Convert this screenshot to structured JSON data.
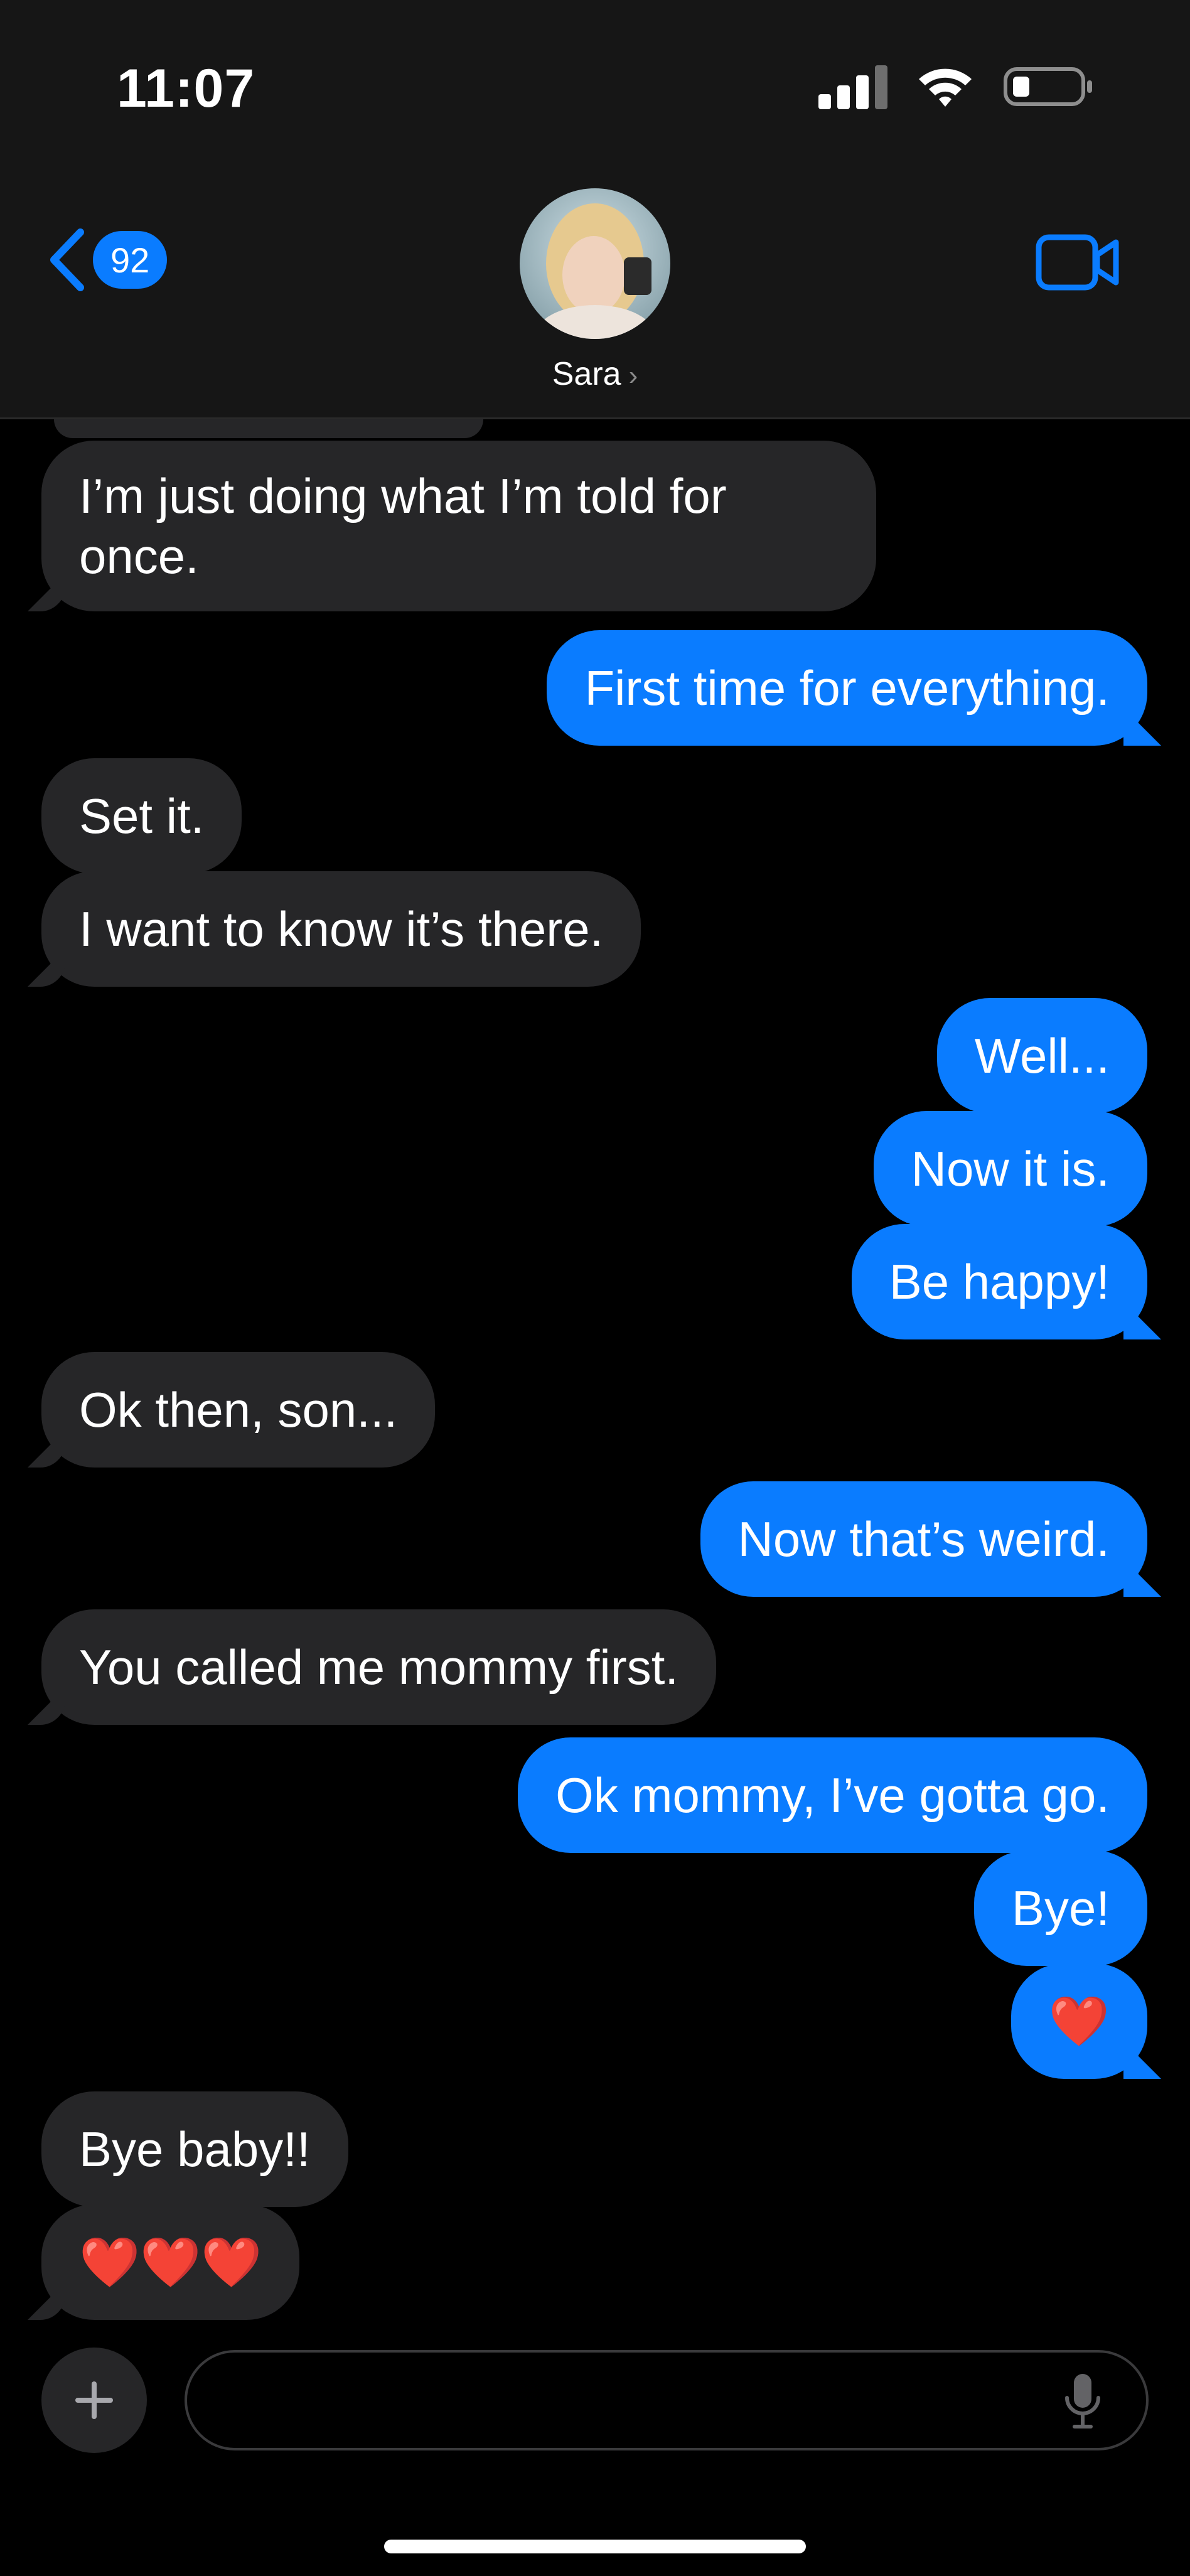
{
  "status_bar": {
    "time": "11:07",
    "icons": [
      "cellular-signal-icon",
      "wifi-icon",
      "battery-icon"
    ]
  },
  "header": {
    "back_badge_count": "92",
    "contact_name": "Sara",
    "contact_chevron": "›",
    "icons": [
      "chevron-left-icon",
      "video-camera-icon"
    ]
  },
  "messages": [
    {
      "side": "in",
      "text": "I’m just doing what I’m told for once."
    },
    {
      "side": "out",
      "text": "First time for everything."
    },
    {
      "side": "in",
      "text": "Set it."
    },
    {
      "side": "in",
      "text": "I want to know it’s there."
    },
    {
      "side": "out",
      "text": "Well..."
    },
    {
      "side": "out",
      "text": "Now it is."
    },
    {
      "side": "out",
      "text": "Be happy!"
    },
    {
      "side": "in",
      "text": "Ok then, son..."
    },
    {
      "side": "out",
      "text": "Now that’s weird."
    },
    {
      "side": "in",
      "text": "You called me mommy first."
    },
    {
      "side": "out",
      "text": "Ok mommy, I’ve gotta go."
    },
    {
      "side": "out",
      "text": "Bye!"
    },
    {
      "side": "out",
      "text": "❤️"
    },
    {
      "side": "in",
      "text": "Bye baby!!"
    },
    {
      "side": "in",
      "text": "❤️❤️❤️"
    }
  ],
  "composer": {
    "placeholder": "",
    "icons": [
      "plus-icon",
      "microphone-icon"
    ]
  },
  "colors": {
    "accent": "#0a7cff",
    "incoming_bubble": "#262628",
    "header_bg": "#161616",
    "background": "#000000"
  }
}
